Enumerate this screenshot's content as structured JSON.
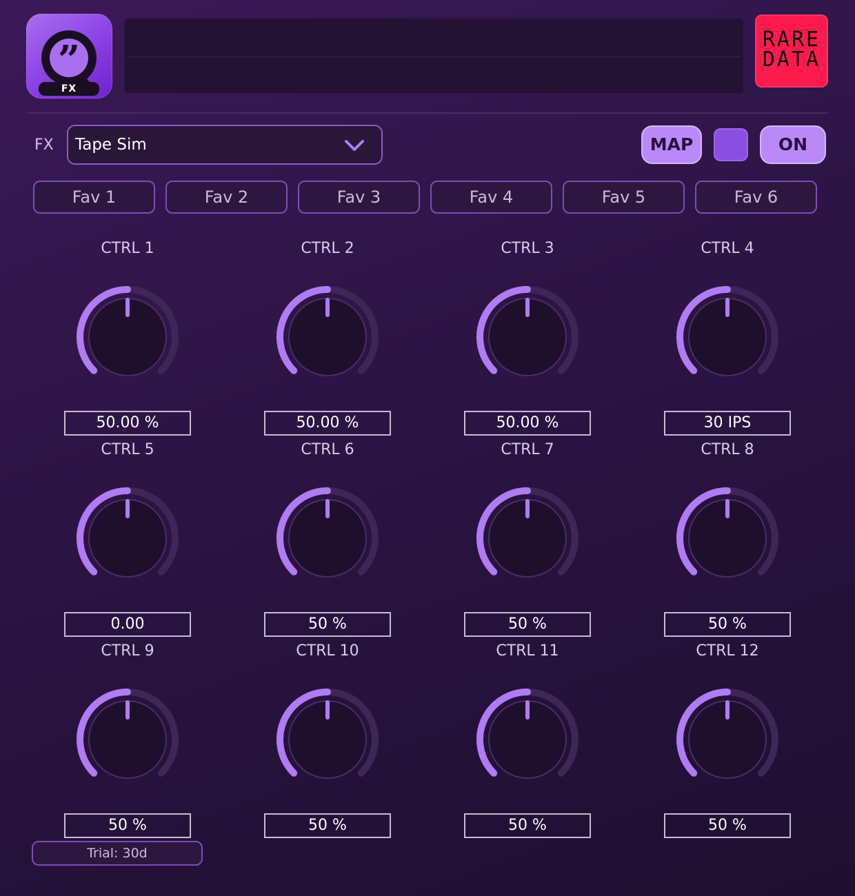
{
  "header": {
    "app_badge": "FX",
    "brand_line1": "RARE",
    "brand_line2": "DATA"
  },
  "fx": {
    "label": "FX",
    "selected": "Tape Sim",
    "map_label": "MAP",
    "power_label": "ON"
  },
  "favorites": [
    "Fav 1",
    "Fav 2",
    "Fav 3",
    "Fav 4",
    "Fav 5",
    "Fav 6"
  ],
  "controls": [
    {
      "label": "CTRL 1",
      "value": "50.00 %",
      "level": 0.5
    },
    {
      "label": "CTRL 2",
      "value": "50.00 %",
      "level": 0.5
    },
    {
      "label": "CTRL 3",
      "value": "50.00 %",
      "level": 0.5
    },
    {
      "label": "CTRL 4",
      "value": "30 IPS",
      "level": 0.5
    },
    {
      "label": "CTRL 5",
      "value": "0.00",
      "level": 0.5
    },
    {
      "label": "CTRL 6",
      "value": "50 %",
      "level": 0.5
    },
    {
      "label": "CTRL 7",
      "value": "50 %",
      "level": 0.5
    },
    {
      "label": "CTRL 8",
      "value": "50 %",
      "level": 0.5
    },
    {
      "label": "CTRL 9",
      "value": "50 %",
      "level": 0.5
    },
    {
      "label": "CTRL 10",
      "value": "50 %",
      "level": 0.5
    },
    {
      "label": "CTRL 11",
      "value": "50 %",
      "level": 0.5
    },
    {
      "label": "CTRL 12",
      "value": "50 %",
      "level": 0.5
    }
  ],
  "trial": "Trial: 30d",
  "colors": {
    "accent": "#b07cf3",
    "track": "#3e2757",
    "brand": "#ff1a4e",
    "knob_body": "#1e0f2c"
  }
}
